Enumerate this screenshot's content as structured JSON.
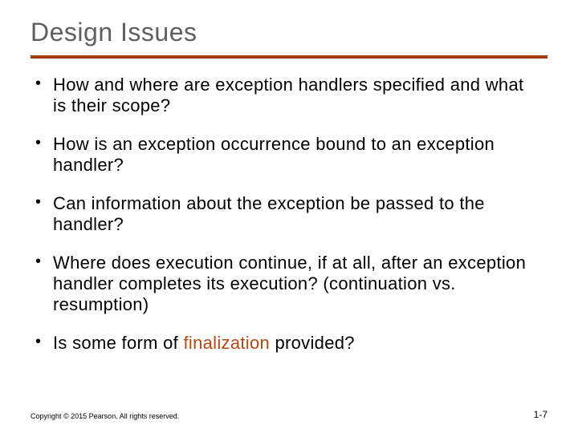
{
  "title": "Design Issues",
  "bullets": [
    "How and where are exception handlers specified and what is their scope?",
    "How is an exception occurrence bound to an exception handler?",
    "Can information about the exception be passed to the handler?",
    "Where does execution continue, if at all, after an exception handler completes its execution? (continuation vs. resumption)",
    "Is some form of |finalization| provided?"
  ],
  "footer": {
    "copyright": "Copyright © 2015 Pearson. All rights reserved.",
    "page": "1-7"
  }
}
